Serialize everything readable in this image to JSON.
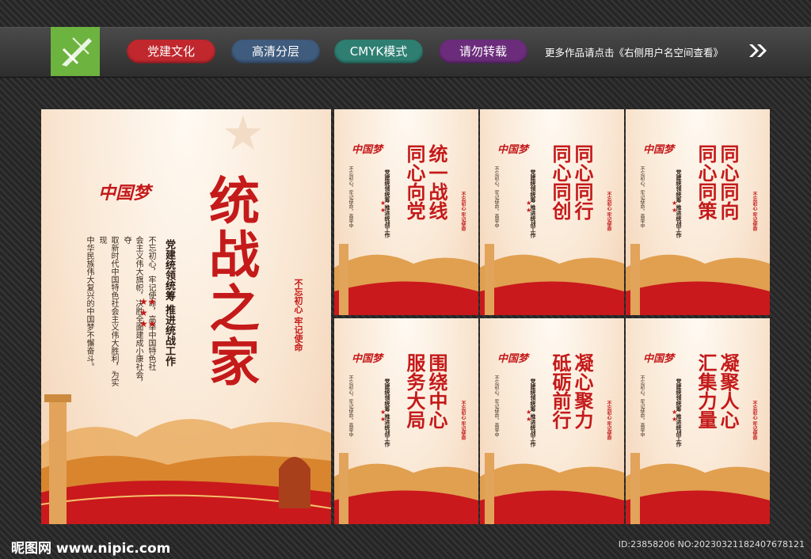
{
  "header": {
    "tags": [
      "党建文化",
      "高清分层",
      "CMYK模式",
      "请勿转载"
    ],
    "more_text": "更多作品请点击《右侧用户名空间查看》"
  },
  "emblem": "中国梦",
  "main_panel": {
    "title": "统战之家",
    "subtitle": "党建统领统筹  推进统战工作",
    "body": [
      "不忘初心，牢记使命，高举中国特色社",
      "会主义伟大旗帜，决胜全面建成小康社会，夺",
      "取新时代中国特色社会主义伟大胜利，为实现",
      "中华民族伟大复兴的中国梦不懈奋斗。"
    ],
    "motto": "不忘初心  牢记使命"
  },
  "small_panels": [
    {
      "title": [
        "统一战线",
        "同心向党"
      ]
    },
    {
      "title": [
        "同心同行",
        "同心同创"
      ]
    },
    {
      "title": [
        "同心同向",
        "同心同策"
      ]
    },
    {
      "title": [
        "围绕中心",
        "服务大局"
      ]
    },
    {
      "title": [
        "凝心聚力",
        "砥砺前行"
      ]
    },
    {
      "title": [
        "凝聚人心",
        "汇集力量"
      ]
    }
  ],
  "small_subtitle": "党建统领统筹  推进统战工作",
  "small_body": [
    "不忘初心，牢记使命，高举中",
    "国特色社会主义伟大旗帜，决胜全",
    "面建成小康社会，夺取新时代中国",
    "特色社会主义伟大胜利，为实现"
  ],
  "small_motto": "不忘初心  牢记使命",
  "footer": {
    "logo": "昵图网 www.nipic.com",
    "id": "ID:23858206 NO:20230321182407678121"
  }
}
